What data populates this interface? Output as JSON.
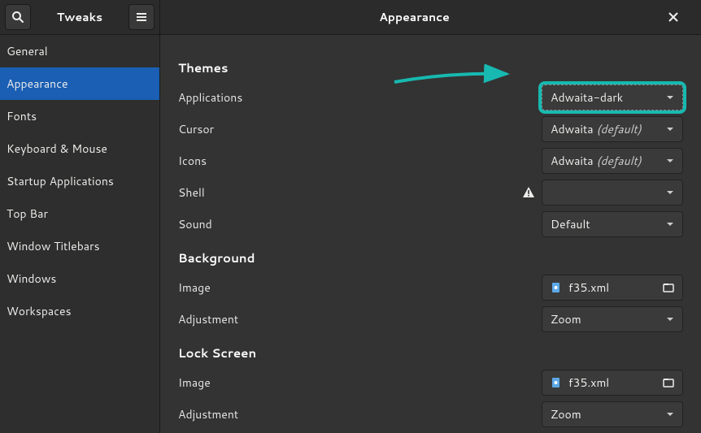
{
  "header": {
    "app_title": "Tweaks",
    "page_title": "Appearance"
  },
  "sidebar": {
    "items": [
      {
        "label": "General"
      },
      {
        "label": "Appearance"
      },
      {
        "label": "Fonts"
      },
      {
        "label": "Keyboard & Mouse"
      },
      {
        "label": "Startup Applications"
      },
      {
        "label": "Top Bar"
      },
      {
        "label": "Window Titlebars"
      },
      {
        "label": "Windows"
      },
      {
        "label": "Workspaces"
      }
    ],
    "active_index": 1
  },
  "sections": {
    "themes": {
      "heading": "Themes",
      "applications": {
        "label": "Applications",
        "value": "Adwaita-dark",
        "highlight": true
      },
      "cursor": {
        "label": "Cursor",
        "value": "Adwaita",
        "default_suffix": "(default)"
      },
      "icons": {
        "label": "Icons",
        "value": "Adwaita",
        "default_suffix": "(default)"
      },
      "shell": {
        "label": "Shell",
        "value": "",
        "warning": true
      },
      "sound": {
        "label": "Sound",
        "value": "Default"
      }
    },
    "background": {
      "heading": "Background",
      "image": {
        "label": "Image",
        "file": "f35.xml"
      },
      "adjustment": {
        "label": "Adjustment",
        "value": "Zoom"
      }
    },
    "lockscreen": {
      "heading": "Lock Screen",
      "image": {
        "label": "Image",
        "file": "f35.xml"
      },
      "adjustment": {
        "label": "Adjustment",
        "value": "Zoom"
      }
    }
  },
  "annotation": {
    "color": "#17b9b0"
  }
}
